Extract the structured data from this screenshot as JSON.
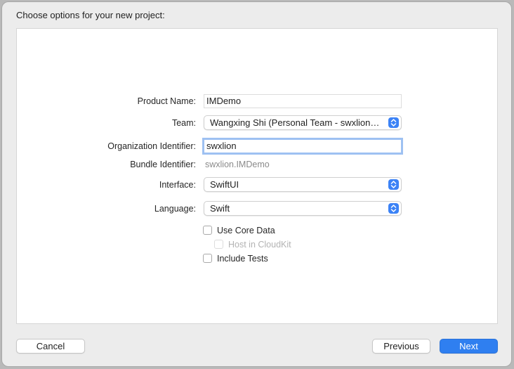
{
  "dialog": {
    "heading": "Choose options for your new project:"
  },
  "form": {
    "product_name": {
      "label": "Product Name:",
      "value": "IMDemo"
    },
    "team": {
      "label": "Team:",
      "value": "Wangxing Shi (Personal Team - swxlion@..."
    },
    "organization_identifier": {
      "label": "Organization Identifier:",
      "value": "swxlion"
    },
    "bundle_identifier": {
      "label": "Bundle Identifier:",
      "value": "swxlion.IMDemo"
    },
    "interface": {
      "label": "Interface:",
      "value": "SwiftUI"
    },
    "language": {
      "label": "Language:",
      "value": "Swift"
    },
    "use_core_data": {
      "label": "Use Core Data",
      "checked": false
    },
    "host_in_cloudkit": {
      "label": "Host in CloudKit",
      "checked": false,
      "disabled": true
    },
    "include_tests": {
      "label": "Include Tests",
      "checked": false
    }
  },
  "buttons": {
    "cancel": "Cancel",
    "previous": "Previous",
    "next": "Next"
  },
  "icons": {
    "popup": "chevron-up-down-icon"
  },
  "colors": {
    "accent": "#2f7ff0",
    "focus_ring": "#9ec1f2"
  }
}
